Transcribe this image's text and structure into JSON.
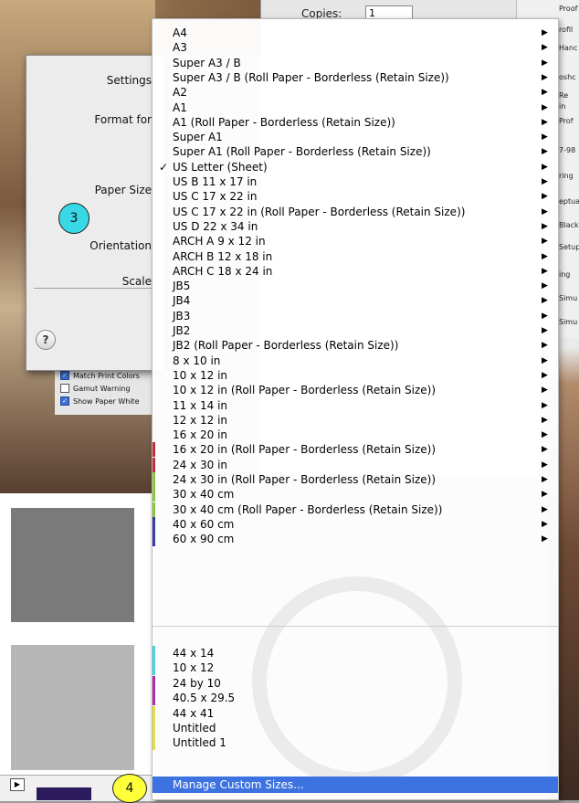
{
  "background": {
    "copies_label": "Copies:",
    "copies_value": "1",
    "proof_panel": [
      "Proof",
      "rofil",
      "Hanc",
      "oshc",
      "Re",
      "in",
      "Prof",
      "7-98",
      "ring",
      "eptua",
      "Black",
      "Setup",
      "ing",
      "Simu",
      "Simu"
    ]
  },
  "page_setup": {
    "labels": [
      "Settings",
      "Format for",
      "Paper Size",
      "Orientation",
      "Scale"
    ],
    "help": "?"
  },
  "color_management": [
    {
      "label": "Match Print Colors",
      "checked": true
    },
    {
      "label": "Gamut Warning",
      "checked": false
    },
    {
      "label": "Show Paper White",
      "checked": true
    }
  ],
  "callouts": {
    "three": "3",
    "four": "4"
  },
  "menu": {
    "items": [
      {
        "label": "A4",
        "arrow": true
      },
      {
        "label": "A3",
        "arrow": true
      },
      {
        "label": "Super A3 / B",
        "arrow": true
      },
      {
        "label": "Super A3 / B (Roll Paper - Borderless (Retain Size))",
        "arrow": true
      },
      {
        "label": "A2",
        "arrow": true
      },
      {
        "label": "A1",
        "arrow": true
      },
      {
        "label": "A1 (Roll Paper - Borderless (Retain Size))",
        "arrow": true
      },
      {
        "label": "Super A1",
        "arrow": true
      },
      {
        "label": "Super A1 (Roll Paper - Borderless (Retain Size))",
        "arrow": true
      },
      {
        "label": "US Letter (Sheet)",
        "arrow": true,
        "checked": true
      },
      {
        "label": "US B 11 x 17 in",
        "arrow": true
      },
      {
        "label": "US C 17 x 22 in",
        "arrow": true
      },
      {
        "label": "US C 17 x 22 in (Roll Paper - Borderless (Retain Size))",
        "arrow": true
      },
      {
        "label": "US D 22 x 34 in",
        "arrow": true
      },
      {
        "label": "ARCH A 9 x 12 in",
        "arrow": true
      },
      {
        "label": "ARCH B 12 x 18 in",
        "arrow": true
      },
      {
        "label": "ARCH C 18 x 24 in",
        "arrow": true
      },
      {
        "label": "JB5",
        "arrow": true
      },
      {
        "label": "JB4",
        "arrow": true
      },
      {
        "label": "JB3",
        "arrow": true
      },
      {
        "label": "JB2",
        "arrow": true
      },
      {
        "label": "JB2 (Roll Paper - Borderless (Retain Size))",
        "arrow": true
      },
      {
        "label": "8 x 10 in",
        "arrow": true
      },
      {
        "label": "10 x 12 in",
        "arrow": true
      },
      {
        "label": "10 x 12 in (Roll Paper - Borderless (Retain Size))",
        "arrow": true
      },
      {
        "label": "11 x 14 in",
        "arrow": true
      },
      {
        "label": "12 x 12 in",
        "arrow": true
      },
      {
        "label": "16 x 20 in",
        "arrow": true
      },
      {
        "label": "16 x 20 in (Roll Paper - Borderless (Retain Size))",
        "arrow": true,
        "bar": "#c0303a"
      },
      {
        "label": "24 x 30 in",
        "arrow": true,
        "bar": "#c0303a"
      },
      {
        "label": "24 x 30 in (Roll Paper - Borderless (Retain Size))",
        "arrow": true,
        "bar": "#8dc63f"
      },
      {
        "label": "30 x 40 cm",
        "arrow": true,
        "bar": "#8dc63f"
      },
      {
        "label": "30 x 40 cm (Roll Paper - Borderless (Retain Size))",
        "arrow": true,
        "bar": "#8dc63f"
      },
      {
        "label": "40 x 60 cm",
        "arrow": true,
        "bar": "#3c3ca8"
      },
      {
        "label": "60 x 90 cm",
        "arrow": true,
        "bar": "#3c3ca8"
      }
    ],
    "custom_items": [
      {
        "label": "44 x 14",
        "bar": "#4fd0e0"
      },
      {
        "label": "10 x 12",
        "bar": "#4fd0e0"
      },
      {
        "label": "24 by 10",
        "bar": "#b02cb0"
      },
      {
        "label": "40.5 x 29.5",
        "bar": "#b02cb0"
      },
      {
        "label": "44 x 41",
        "bar": "#e0e040"
      },
      {
        "label": "Untitled",
        "bar": "#e0e040"
      },
      {
        "label": "Untitled 1",
        "bar": "#e0e040"
      }
    ],
    "manage_label": "Manage Custom Sizes...",
    "highlight_color": "#3d73e0"
  }
}
